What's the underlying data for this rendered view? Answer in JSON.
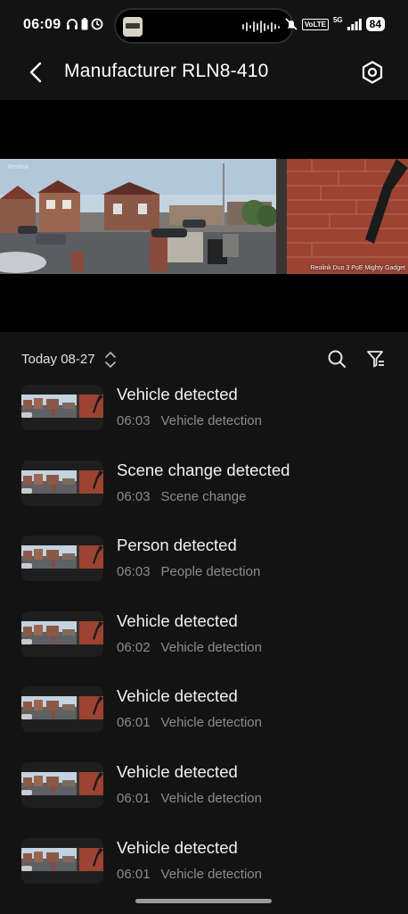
{
  "status_bar": {
    "time": "06:09",
    "left_icons": [
      "headphones-icon",
      "battery-saver-icon",
      "sync-icon"
    ],
    "volte": "VoLTE",
    "network": "5G",
    "battery": "84"
  },
  "header": {
    "title": "Manufacturer RLN8-410",
    "back_icon": "chevron-left-icon",
    "settings_icon": "settings-icon"
  },
  "video": {
    "brand_watermark": "Reolink",
    "overlay_text": "Reolink Duo 3 PoE Mighty Gadget"
  },
  "date_bar": {
    "label": "Today 08-27",
    "search_icon": "search-icon",
    "filter_icon": "filter-icon"
  },
  "events": [
    {
      "title": "Vehicle detected",
      "time": "06:03",
      "type": "Vehicle detection"
    },
    {
      "title": "Scene change detected",
      "time": "06:03",
      "type": "Scene change"
    },
    {
      "title": "Person detected",
      "time": "06:03",
      "type": "People detection"
    },
    {
      "title": "Vehicle detected",
      "time": "06:02",
      "type": "Vehicle detection"
    },
    {
      "title": "Vehicle detected",
      "time": "06:01",
      "type": "Vehicle detection"
    },
    {
      "title": "Vehicle detected",
      "time": "06:01",
      "type": "Vehicle detection"
    },
    {
      "title": "Vehicle detected",
      "time": "06:01",
      "type": "Vehicle detection"
    }
  ]
}
